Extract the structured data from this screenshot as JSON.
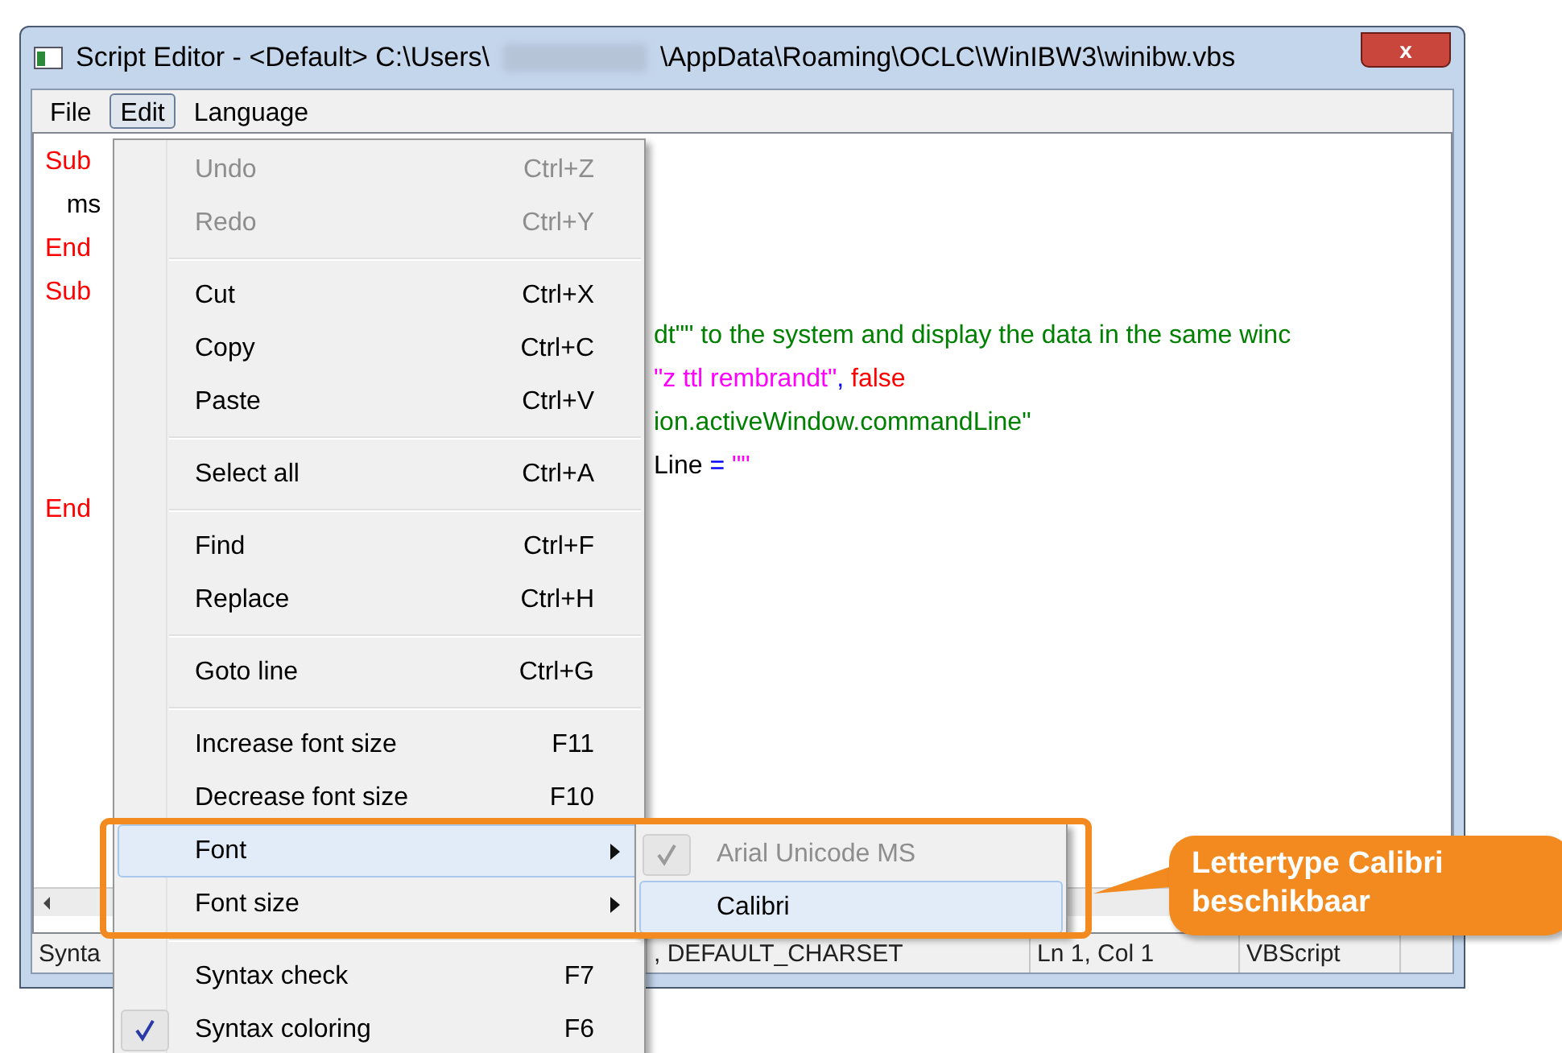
{
  "window": {
    "title_start": "Script Editor - <Default> C:\\Users\\",
    "title_end": "\\AppData\\Roaming\\OCLC\\WinIBW3\\winibw.vbs",
    "close": "x"
  },
  "menu_bar": [
    {
      "label": "File",
      "selected": false
    },
    {
      "label": "Edit",
      "selected": true
    },
    {
      "label": "Language",
      "selected": false
    }
  ],
  "code_lines": [
    {
      "left": [
        {
          "kind": "keyword",
          "text": "Sub"
        }
      ]
    },
    {
      "left": [
        {
          "kind": "plain",
          "text": "   ms"
        }
      ]
    },
    {
      "left": [
        {
          "kind": "keyword",
          "text": "End"
        }
      ]
    },
    {
      "left": [
        {
          "kind": "keyword",
          "text": "Sub"
        }
      ]
    },
    {
      "right": [
        {
          "kind": "comment",
          "text": "dt\"\" to the system and display the data in the same winc"
        }
      ]
    },
    {
      "right": [
        {
          "kind": "string",
          "text": "\"z ttl rembrandt\""
        },
        {
          "kind": "operator",
          "text": ","
        },
        {
          "kind": "keyword",
          "text": " false"
        }
      ]
    },
    {
      "right": [
        {
          "kind": "comment",
          "text": "ion.activeWindow.commandLine\""
        }
      ]
    },
    {
      "right": [
        {
          "kind": "plain",
          "text": "Line "
        },
        {
          "kind": "operator",
          "text": "="
        },
        {
          "kind": "string",
          "text": " \"\""
        }
      ]
    },
    {
      "left": [
        {
          "kind": "keyword",
          "text": "End"
        }
      ]
    }
  ],
  "status_bar": {
    "left": "Synta",
    "charset": ", DEFAULT_CHARSET",
    "position": "Ln 1, Col 1",
    "language": "VBScript"
  },
  "edit_menu": [
    {
      "kind": "item",
      "label": "Undo",
      "shortcut": "Ctrl+Z",
      "disabled": true,
      "checked": false,
      "selected": false,
      "submenu": false
    },
    {
      "kind": "item",
      "label": "Redo",
      "shortcut": "Ctrl+Y",
      "disabled": true,
      "checked": false,
      "selected": false,
      "submenu": false
    },
    {
      "kind": "separator"
    },
    {
      "kind": "item",
      "label": "Cut",
      "shortcut": "Ctrl+X",
      "disabled": false,
      "checked": false,
      "selected": false,
      "submenu": false
    },
    {
      "kind": "item",
      "label": "Copy",
      "shortcut": "Ctrl+C",
      "disabled": false,
      "checked": false,
      "selected": false,
      "submenu": false
    },
    {
      "kind": "item",
      "label": "Paste",
      "shortcut": "Ctrl+V",
      "disabled": false,
      "checked": false,
      "selected": false,
      "submenu": false
    },
    {
      "kind": "separator"
    },
    {
      "kind": "item",
      "label": "Select all",
      "shortcut": "Ctrl+A",
      "disabled": false,
      "checked": false,
      "selected": false,
      "submenu": false
    },
    {
      "kind": "separator"
    },
    {
      "kind": "item",
      "label": "Find",
      "shortcut": "Ctrl+F",
      "disabled": false,
      "checked": false,
      "selected": false,
      "submenu": false
    },
    {
      "kind": "item",
      "label": "Replace",
      "shortcut": "Ctrl+H",
      "disabled": false,
      "checked": false,
      "selected": false,
      "submenu": false
    },
    {
      "kind": "separator"
    },
    {
      "kind": "item",
      "label": "Goto line",
      "shortcut": "Ctrl+G",
      "disabled": false,
      "checked": false,
      "selected": false,
      "submenu": false
    },
    {
      "kind": "separator"
    },
    {
      "kind": "item",
      "label": "Increase font size",
      "shortcut": "F11",
      "disabled": false,
      "checked": false,
      "selected": false,
      "submenu": false
    },
    {
      "kind": "item",
      "label": "Decrease font size",
      "shortcut": "F10",
      "disabled": false,
      "checked": false,
      "selected": false,
      "submenu": false
    },
    {
      "kind": "item",
      "label": "Font",
      "disabled": false,
      "checked": false,
      "selected": true,
      "submenu": true
    },
    {
      "kind": "item",
      "label": "Font size",
      "disabled": false,
      "checked": false,
      "selected": false,
      "submenu": true
    },
    {
      "kind": "separator"
    },
    {
      "kind": "item",
      "label": "Syntax check",
      "shortcut": "F7",
      "disabled": false,
      "checked": false,
      "selected": false,
      "submenu": false
    },
    {
      "kind": "item",
      "label": "Syntax coloring",
      "shortcut": "F6",
      "disabled": false,
      "checked": true,
      "selected": false,
      "submenu": false
    }
  ],
  "font_submenu": [
    {
      "label": "Arial Unicode MS",
      "disabled": true,
      "checked": true,
      "selected": false
    },
    {
      "label": "Calibri",
      "disabled": false,
      "checked": false,
      "selected": true
    }
  ],
  "callout": {
    "line1": "Lettertype Calibri",
    "line2": "beschikbaar"
  }
}
